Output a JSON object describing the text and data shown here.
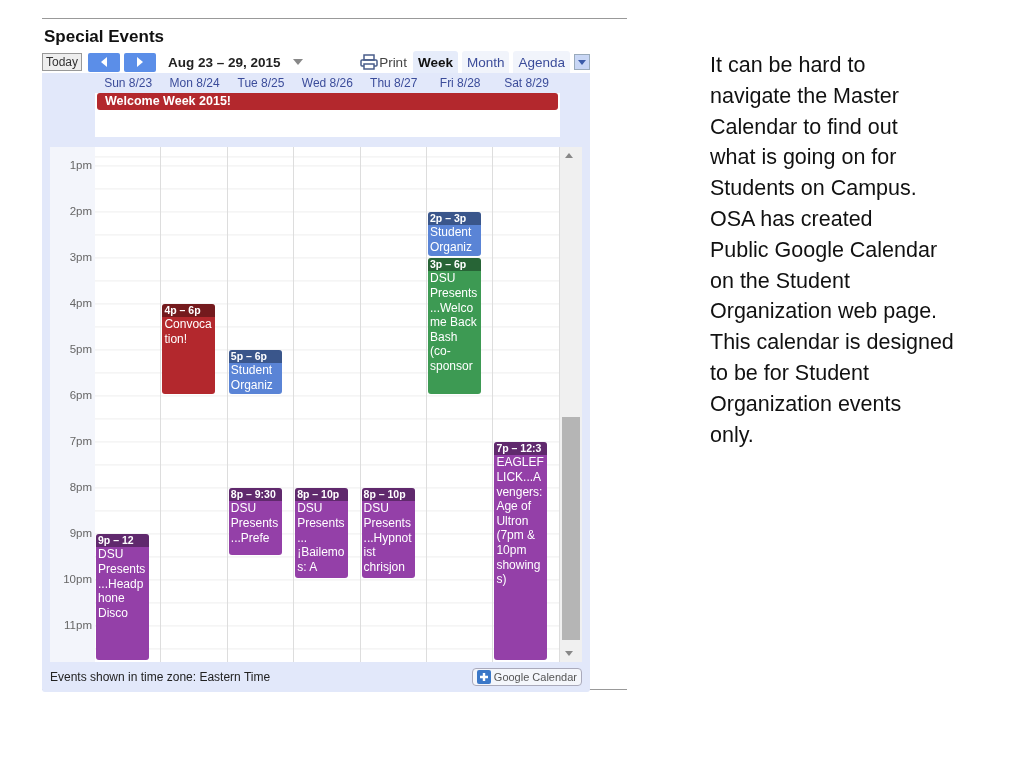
{
  "calendar": {
    "title": "Special Events",
    "toolbar": {
      "today": "Today",
      "range": "Aug 23 – 29, 2015",
      "print": "Print",
      "tabs": [
        {
          "label": "Week",
          "selected": true
        },
        {
          "label": "Month",
          "selected": false
        },
        {
          "label": "Agenda",
          "selected": false
        }
      ]
    },
    "all_day": [
      {
        "title": "Welcome Week 2015!",
        "color": "#b3282d"
      }
    ],
    "hours": [
      "1pm",
      "2pm",
      "3pm",
      "4pm",
      "5pm",
      "6pm",
      "7pm",
      "8pm",
      "9pm",
      "10pm",
      "11pm"
    ],
    "days": [
      {
        "label": "Sun 8/23",
        "events": [
          {
            "time": "9p – 12",
            "title": "DSU Presents...Headphone Disco",
            "color": "#9440a8"
          }
        ]
      },
      {
        "label": "Mon 8/24",
        "events": [
          {
            "time": "4p – 6p",
            "title": "Convocation!",
            "color": "#b3282d"
          }
        ]
      },
      {
        "label": "Tue 8/25",
        "events": [
          {
            "time": "5p – 6p",
            "title": "Student Organiz",
            "color": "#5a84d6"
          },
          {
            "time": "8p – 9:30",
            "title": "DSU Presents...Prefe",
            "color": "#9440a8"
          }
        ]
      },
      {
        "label": "Wed 8/26",
        "events": [
          {
            "time": "8p – 10p",
            "title": "DSU Presents... ¡Bailemos: A",
            "color": "#9440a8"
          }
        ]
      },
      {
        "label": "Thu 8/27",
        "events": [
          {
            "time": "8p – 10p",
            "title": "DSU Presents...Hypnotist chrisjon",
            "color": "#9440a8"
          }
        ]
      },
      {
        "label": "Fri 8/28",
        "events": [
          {
            "time": "2p – 3p",
            "title": "Student Organiz",
            "color": "#5a84d6"
          },
          {
            "time": "3p – 6p",
            "title": "DSU Presents...Welcome Back Bash (co-sponsor",
            "color": "#3d9a53"
          }
        ]
      },
      {
        "label": "Sat 8/29",
        "events": [
          {
            "time": "7p – 12:3",
            "title": "EAGLEFLICK...Avengers: Age of Ultron (7pm & 10pm showings)",
            "color": "#9440a8"
          }
        ]
      }
    ],
    "footer": {
      "timezone": "Events shown in time zone: Eastern Time",
      "badge": "Google Calendar"
    }
  },
  "note_lines": [
    "It can be hard to",
    "navigate the Master",
    "Calendar to find out",
    "what is going on for",
    "Students on Campus.",
    "OSA has created",
    "Public Google Calendar",
    "on the Student",
    "Organization web page.",
    "This calendar is designed",
    "to be for Student",
    "Organization events",
    "only."
  ]
}
